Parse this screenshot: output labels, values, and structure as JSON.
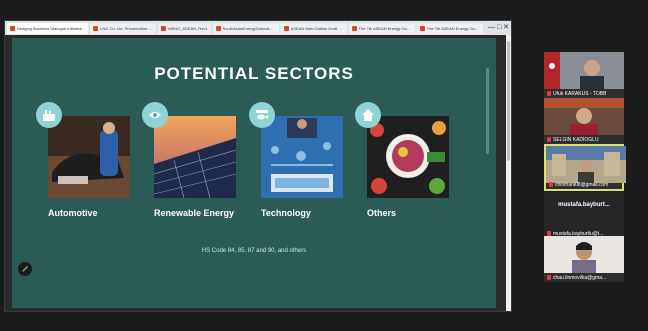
{
  "browser": {
    "tabs": [
      {
        "label": "Hedging Business Dialogue Initiative..."
      },
      {
        "label": "LNG Co. Ltd. Presentation - P..."
      },
      {
        "label": "MENG_ASEAN_Rev1"
      },
      {
        "label": "SouthAsianEnergyOutlook2019"
      },
      {
        "label": "ASEAN Web Outline Draft 2..."
      },
      {
        "label": "The 7th ASEAN Energy Outlook (AEO..."
      },
      {
        "label": "The 7th ASEAN Energy Outlook Sum..."
      }
    ],
    "window_controls": "— □ ✕"
  },
  "slide": {
    "title": "POTENTIAL SECTORS",
    "sectors": [
      {
        "label": "Automotive",
        "icon": "factory-icon"
      },
      {
        "label": "Renewable Energy",
        "icon": "eye-icon"
      },
      {
        "label": "Technology",
        "icon": "fish-tech-icon"
      },
      {
        "label": "Others",
        "icon": "home-check-icon"
      }
    ],
    "hs_code": "HS Code 84, 85, 87 and 90, and others"
  },
  "participants": [
    {
      "name": "Ufuk KARAKUS - TOBB",
      "mic_muted": true
    },
    {
      "name": "SELGIN KADIOĞLU",
      "mic_muted": true
    },
    {
      "name": "chinthani08@gmail.com",
      "mic_muted": true,
      "speaking": true
    },
    {
      "name": "mustafa.bayburt...",
      "display_name": "mustafa.bayburtlu@t...",
      "mic_muted": true
    },
    {
      "name": "chau.linmovilka@gma...",
      "mic_muted": true
    }
  ],
  "colors": {
    "slide_bg": "#2b5b55",
    "icon_circle": "#8fd3d6",
    "speaking_border": "#d8e36a",
    "mic_red": "#e23b3b"
  }
}
